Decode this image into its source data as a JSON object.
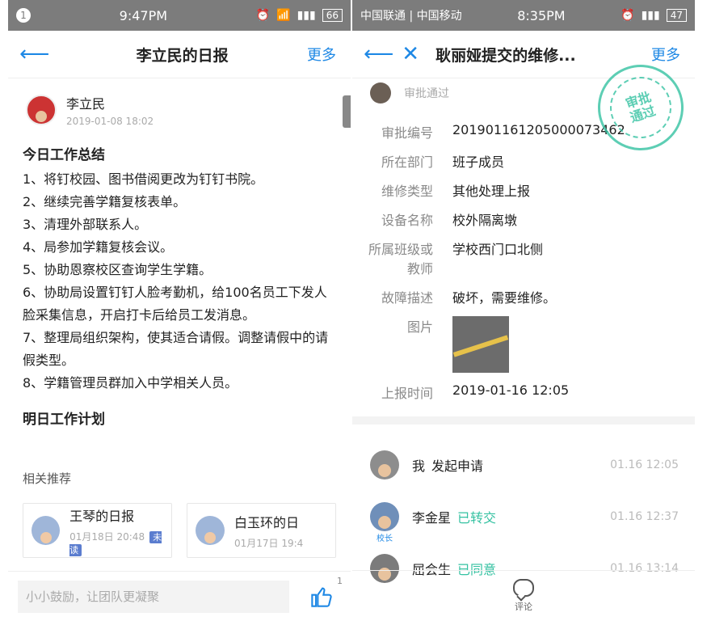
{
  "left": {
    "status_bar": {
      "left_badge": "1",
      "time": "9:47PM",
      "battery": "66"
    },
    "nav": {
      "title": "李立民的日报",
      "more_label": "更多"
    },
    "author": {
      "name": "李立民",
      "date": "2019-01-08 18:02"
    },
    "today_title": "今日工作总结",
    "today_items": [
      "1、将钉校园、图书借阅更改为钉钉书院。",
      "2、继续完善学籍复核表单。",
      "3、清理外部联系人。",
      "4、局参加学籍复核会议。",
      "5、协助恩察校区查询学生学籍。",
      "6、协助局设置钉钉人脸考勤机，给100名员工下发人脸采集信息，开启打卡后给员工发消息。",
      "7、整理局组织架构，使其适合请假。调整请假中的请假类型。",
      "8、学籍管理员群加入中学相关人员。"
    ],
    "tomorrow_title": "明日工作计划",
    "recommend_title": "相关推荐",
    "cards": [
      {
        "title": "王琴的日报",
        "date": "01月18日 20:48",
        "badge": "未读"
      },
      {
        "title": "白玉环的日",
        "date": "01月17日 19:4"
      }
    ],
    "footer": {
      "input_placeholder": "小小鼓励，让团队更凝聚",
      "like_count": "1"
    }
  },
  "right": {
    "status_bar": {
      "carriers": "中国联通 | 中国移动",
      "time": "8:35PM",
      "battery": "47"
    },
    "nav": {
      "title": "耿丽娅提交的维修...",
      "more_label": "更多"
    },
    "partial_text": "审批通过",
    "stamp": {
      "line1": "审批",
      "line2": "通过"
    },
    "details": [
      {
        "label": "审批编号",
        "value": "201901161205000073462"
      },
      {
        "label": "所在部门",
        "value": "班子成员"
      },
      {
        "label": "维修类型",
        "value": "其他处理上报"
      },
      {
        "label": "设备名称",
        "value": "校外隔离墩"
      },
      {
        "label": "所属班级或教师",
        "value": "学校西门口北侧"
      },
      {
        "label": "故障描述",
        "value": "破坏，需要维修。"
      }
    ],
    "image_label": "图片",
    "report_time_label": "上报时间",
    "report_time_value": "2019-01-16 12:05",
    "timeline": [
      {
        "name": "我",
        "status": "发起申请",
        "time": "01.16 12:05"
      },
      {
        "name": "李金星",
        "status": "已转交",
        "time": "01.16 12:37",
        "role": "校长"
      },
      {
        "name": "屈会生",
        "status": "已同意",
        "time": "01.16 13:14"
      }
    ],
    "footer": {
      "comment_label": "评论"
    }
  },
  "colors": {
    "accent": "#1e88e5",
    "success": "#35c2a2",
    "status_bar": "#7c7c7c"
  }
}
